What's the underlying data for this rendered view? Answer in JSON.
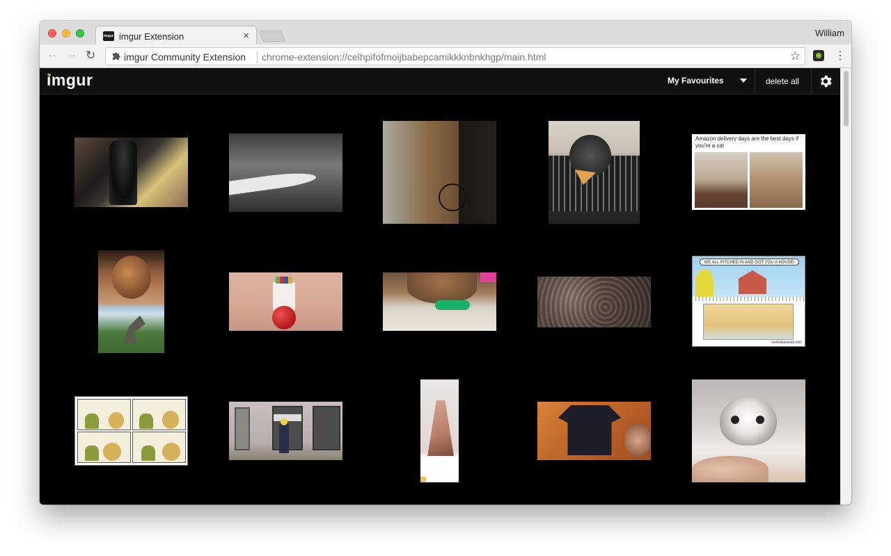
{
  "browser": {
    "tab_title": "imgur Extension",
    "tab_favicon_text": "imgur",
    "tab_close": "×",
    "profile_name": "William",
    "nav": {
      "back": "←",
      "forward": "→",
      "reload": "↻"
    },
    "omnibox": {
      "site_name": "imgur Community Extension",
      "url": "chrome-extension://celhpifofmoijbabepcamikkknbnkhgp/main.html",
      "star": "☆"
    },
    "menu": "⋮"
  },
  "app": {
    "logo": "imgur",
    "favourites_select": "My Favourites",
    "delete_all": "delete all"
  },
  "gallery": [
    {
      "id": "t1",
      "desc": "Darth Vader costume in crowd"
    },
    {
      "id": "t2",
      "desc": "Black and white grainy image"
    },
    {
      "id": "t3",
      "desc": "Split image with cables"
    },
    {
      "id": "t4",
      "desc": "Dog holding pizza on mat"
    },
    {
      "id": "t5",
      "desc": "Amazon delivery days cat meme",
      "caption": "Amazon delivery days are the best days if you're a cat"
    },
    {
      "id": "t6",
      "desc": "Egg and dinosaur"
    },
    {
      "id": "t7",
      "desc": "Red ball near pencil cup"
    },
    {
      "id": "t8",
      "desc": "Cat with fidget spinner"
    },
    {
      "id": "t9",
      "desc": "Grey rocky ground"
    },
    {
      "id": "t10",
      "desc": "Comic house cartoon",
      "caption": "WE ALL PITCHED IN AND GOT YOU A HOUSE!",
      "footer": "berkeleymews.com"
    },
    {
      "id": "t11",
      "desc": "Four-panel dog comic"
    },
    {
      "id": "t12",
      "desc": "Simpsons-style hallway"
    },
    {
      "id": "t13",
      "desc": "Hand reaching"
    },
    {
      "id": "t14",
      "desc": "Shirt folding"
    },
    {
      "id": "t15",
      "desc": "Grey cat"
    }
  ]
}
